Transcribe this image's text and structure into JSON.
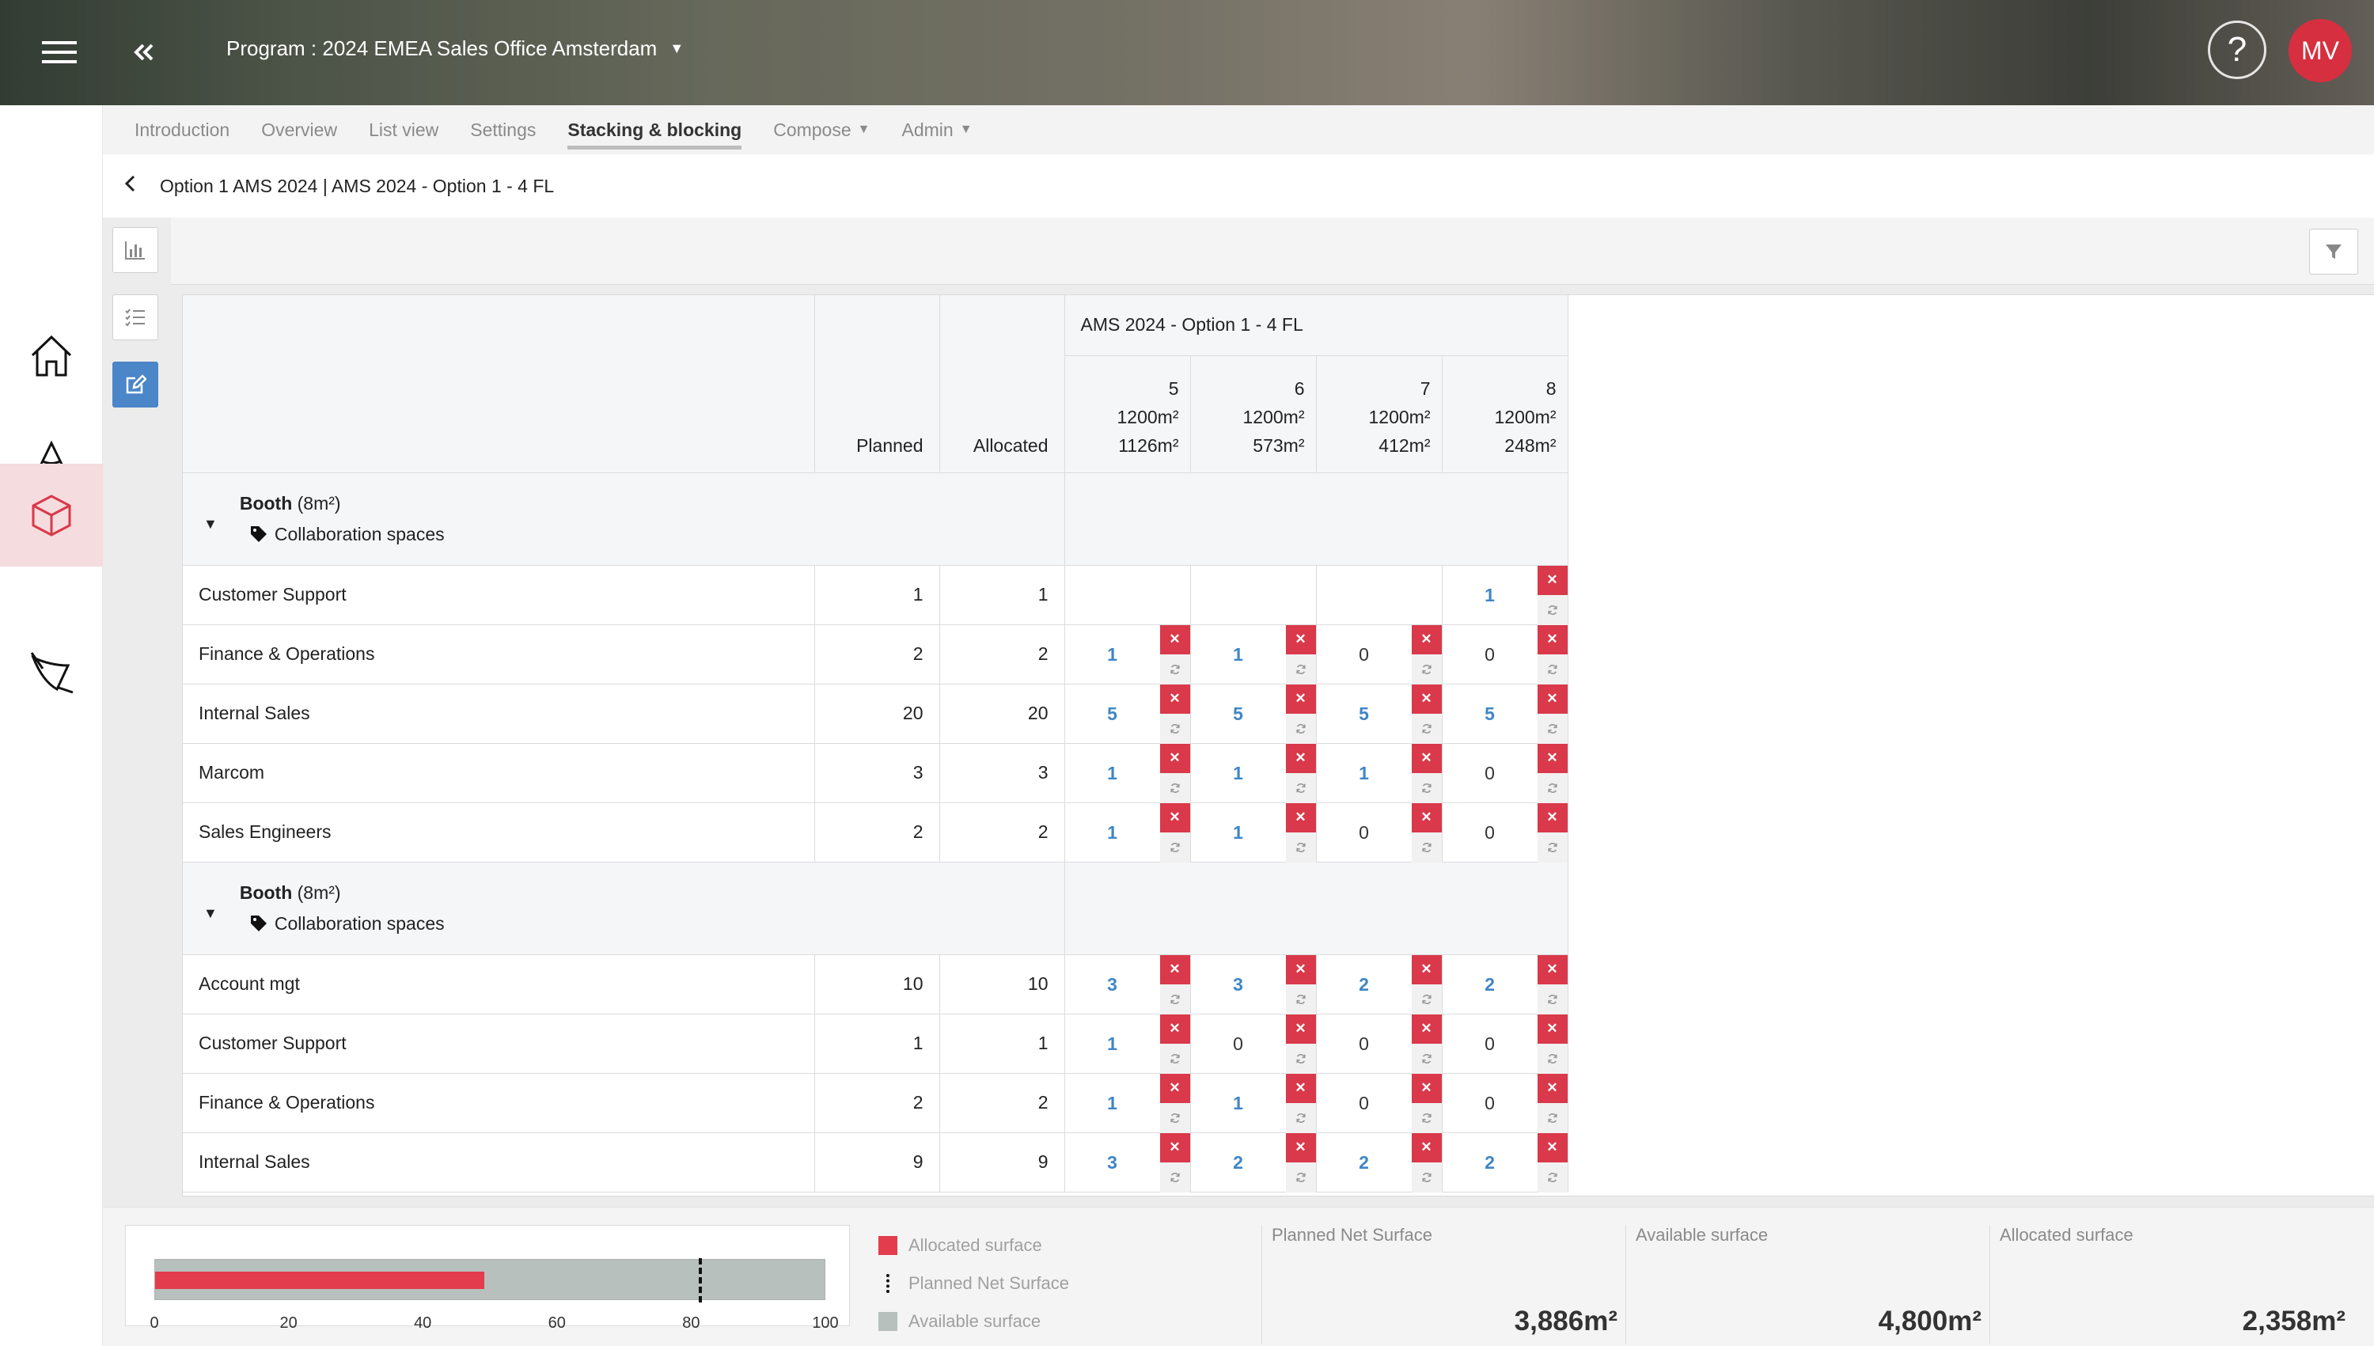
{
  "header": {
    "program_title": "Program : 2024 EMEA Sales Office Amsterdam",
    "avatar_initials": "MV"
  },
  "rail": {
    "items": [
      {
        "icon": "home-icon"
      },
      {
        "icon": "cone-icon"
      },
      {
        "icon": "cube-icon",
        "active": true
      },
      {
        "icon": "compose-icon"
      }
    ]
  },
  "tabs": [
    {
      "label": "Introduction"
    },
    {
      "label": "Overview"
    },
    {
      "label": "List view"
    },
    {
      "label": "Settings"
    },
    {
      "label": "Stacking & blocking",
      "active": true
    },
    {
      "label": "Compose",
      "dropdown": true
    },
    {
      "label": "Admin",
      "dropdown": true
    }
  ],
  "breadcrumb": "Option 1 AMS 2024 | AMS 2024 - Option 1 - 4 FL",
  "grid": {
    "option_title": "AMS 2024 - Option 1 - 4 FL",
    "col_planned": "Planned",
    "col_allocated": "Allocated",
    "floors": [
      {
        "number": "5",
        "capacity": "1200m²",
        "used": "1126m²"
      },
      {
        "number": "6",
        "capacity": "1200m²",
        "used": "573m²"
      },
      {
        "number": "7",
        "capacity": "1200m²",
        "used": "412m²"
      },
      {
        "number": "8",
        "capacity": "1200m²",
        "used": "248m²"
      }
    ],
    "groups": [
      {
        "title": "Booth",
        "size": "(8m²)",
        "category": "Collaboration spaces",
        "rows": [
          {
            "name": "Customer Support",
            "planned": "1",
            "allocated": "1",
            "floors": [
              "",
              "",
              "",
              "1"
            ]
          },
          {
            "name": "Finance & Operations",
            "planned": "2",
            "allocated": "2",
            "floors": [
              "1",
              "1",
              "0",
              "0"
            ]
          },
          {
            "name": "Internal Sales",
            "planned": "20",
            "allocated": "20",
            "floors": [
              "5",
              "5",
              "5",
              "5"
            ]
          },
          {
            "name": "Marcom",
            "planned": "3",
            "allocated": "3",
            "floors": [
              "1",
              "1",
              "1",
              "0"
            ]
          },
          {
            "name": "Sales Engineers",
            "planned": "2",
            "allocated": "2",
            "floors": [
              "1",
              "1",
              "0",
              "0"
            ]
          }
        ]
      },
      {
        "title": "Booth",
        "size": "(8m²)",
        "category": "Collaboration spaces",
        "rows": [
          {
            "name": "Account mgt",
            "planned": "10",
            "allocated": "10",
            "floors": [
              "3",
              "3",
              "2",
              "2"
            ]
          },
          {
            "name": "Customer Support",
            "planned": "1",
            "allocated": "1",
            "floors": [
              "1",
              "0",
              "0",
              "0"
            ]
          },
          {
            "name": "Finance & Operations",
            "planned": "2",
            "allocated": "2",
            "floors": [
              "1",
              "1",
              "0",
              "0"
            ]
          },
          {
            "name": "Internal Sales",
            "planned": "9",
            "allocated": "9",
            "floors": [
              "3",
              "2",
              "2",
              "2"
            ]
          }
        ]
      }
    ]
  },
  "summary": {
    "bar": {
      "allocated_percent": 49,
      "planned_marker_percent": 81,
      "ticks": [
        "0",
        "20",
        "40",
        "60",
        "80",
        "100"
      ]
    },
    "legend": [
      {
        "label": "Allocated surface",
        "color": "#e23c4d"
      },
      {
        "label": "Planned Net Surface",
        "color": "#111111"
      },
      {
        "label": "Available surface",
        "color": "#b7c0bd"
      }
    ],
    "stats": [
      {
        "label": "Planned Net Surface",
        "value": "3,886m²"
      },
      {
        "label": "Available surface",
        "value": "4,800m²"
      },
      {
        "label": "Allocated surface",
        "value": "2,358m²"
      }
    ]
  }
}
